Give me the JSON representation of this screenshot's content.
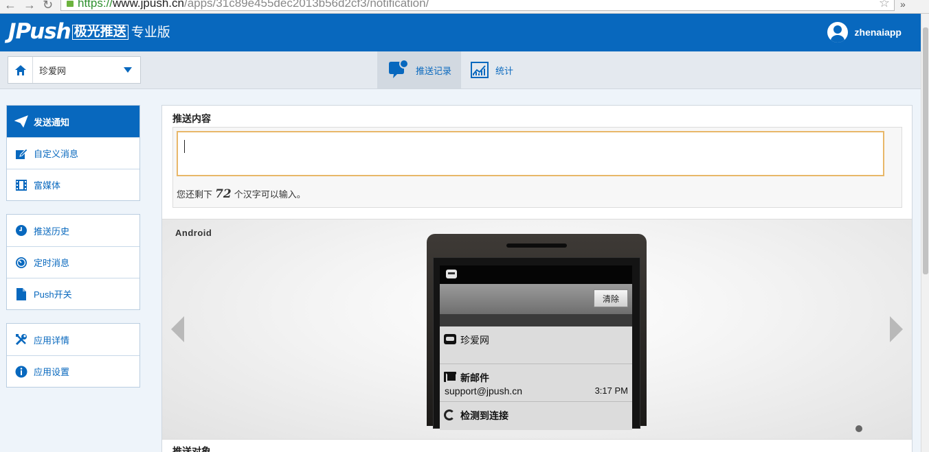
{
  "browser": {
    "url_scheme": "https://",
    "url_host": "www.jpush.cn",
    "url_path": "/apps/31c89e455dec2013b56d2cf3/notification/"
  },
  "header": {
    "logo_text": "JPush",
    "logo_cn": "极光推送",
    "edition": "专业版",
    "username": "zhenaiapp"
  },
  "toolbar": {
    "app_name": "珍爱网",
    "tabs": [
      {
        "label": "推送记录",
        "icon": "chat-bubble-icon",
        "active": true
      },
      {
        "label": "统计",
        "icon": "chart-icon",
        "active": false
      }
    ]
  },
  "sidebar": {
    "group1": [
      {
        "label": "发送通知",
        "icon": "paper-plane-icon",
        "active": true
      },
      {
        "label": "自定义消息",
        "icon": "edit-icon"
      },
      {
        "label": "富媒体",
        "icon": "film-icon"
      }
    ],
    "group2": [
      {
        "label": "推送历史",
        "icon": "clock-icon"
      },
      {
        "label": "定时消息",
        "icon": "timer-icon"
      },
      {
        "label": "Push开关",
        "icon": "document-icon"
      }
    ],
    "group3": [
      {
        "label": "应用详情",
        "icon": "tools-icon"
      },
      {
        "label": "应用设置",
        "icon": "info-icon"
      }
    ]
  },
  "main": {
    "content_title": "推送内容",
    "message_value": "",
    "counter_prefix": "您还剩下",
    "counter_value": "72",
    "counter_suffix": "个汉字可以输入。",
    "preview_platform": "Android",
    "phone": {
      "clear_label": "清除",
      "notifications": [
        {
          "title": "珍爱网",
          "line": "",
          "time": "",
          "icon": "chat-icon"
        },
        {
          "title": "新邮件",
          "line": "support@jpush.cn",
          "time": "3:17 PM",
          "icon": "mail-icon"
        },
        {
          "title": "检测到连接",
          "line": "",
          "time": "",
          "icon": "sync-icon"
        }
      ]
    },
    "target_title": "推送对象"
  },
  "colors": {
    "brand_blue": "#0868be",
    "input_border": "#e8b768"
  }
}
